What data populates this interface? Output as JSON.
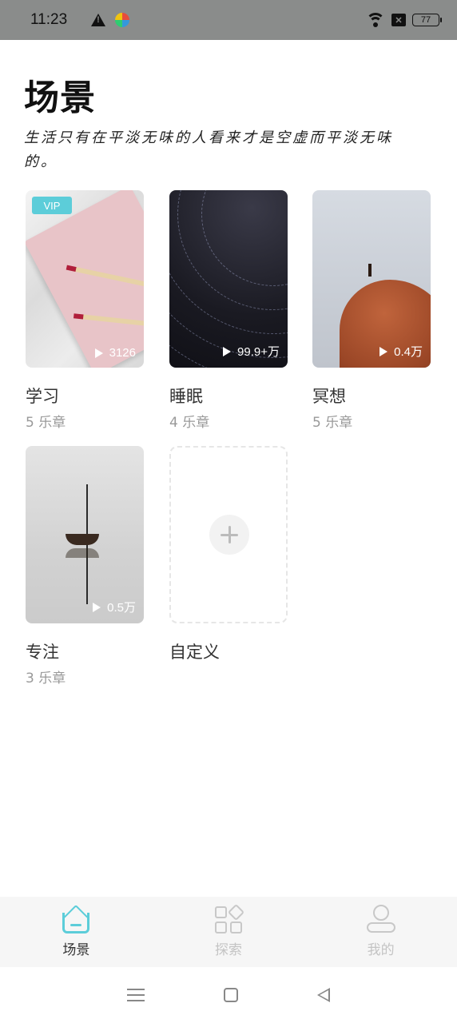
{
  "status_bar": {
    "time": "11:23",
    "sim_label": "✕",
    "battery": "77"
  },
  "header": {
    "title": "场景",
    "subtitle": "生活只有在平淡无味的人看来才是空虚而平淡无味的。"
  },
  "cards": [
    {
      "name": "学习",
      "count": "5 乐章",
      "plays": "3126",
      "badge": "VIP"
    },
    {
      "name": "睡眠",
      "count": "4 乐章",
      "plays": "99.9+万"
    },
    {
      "name": "冥想",
      "count": "5 乐章",
      "plays": "0.4万"
    },
    {
      "name": "专注",
      "count": "3 乐章",
      "plays": "0.5万"
    }
  ],
  "custom_card": {
    "name": "自定义"
  },
  "bottom_nav": {
    "items": [
      {
        "label": "场景",
        "icon": "home-icon",
        "active": true
      },
      {
        "label": "探索",
        "icon": "explore-icon",
        "active": false
      },
      {
        "label": "我的",
        "icon": "profile-icon",
        "active": false
      }
    ]
  },
  "colors": {
    "accent": "#5ccdd9",
    "status_bar": "#8a8c8b",
    "inactive": "#c4c4c4"
  }
}
